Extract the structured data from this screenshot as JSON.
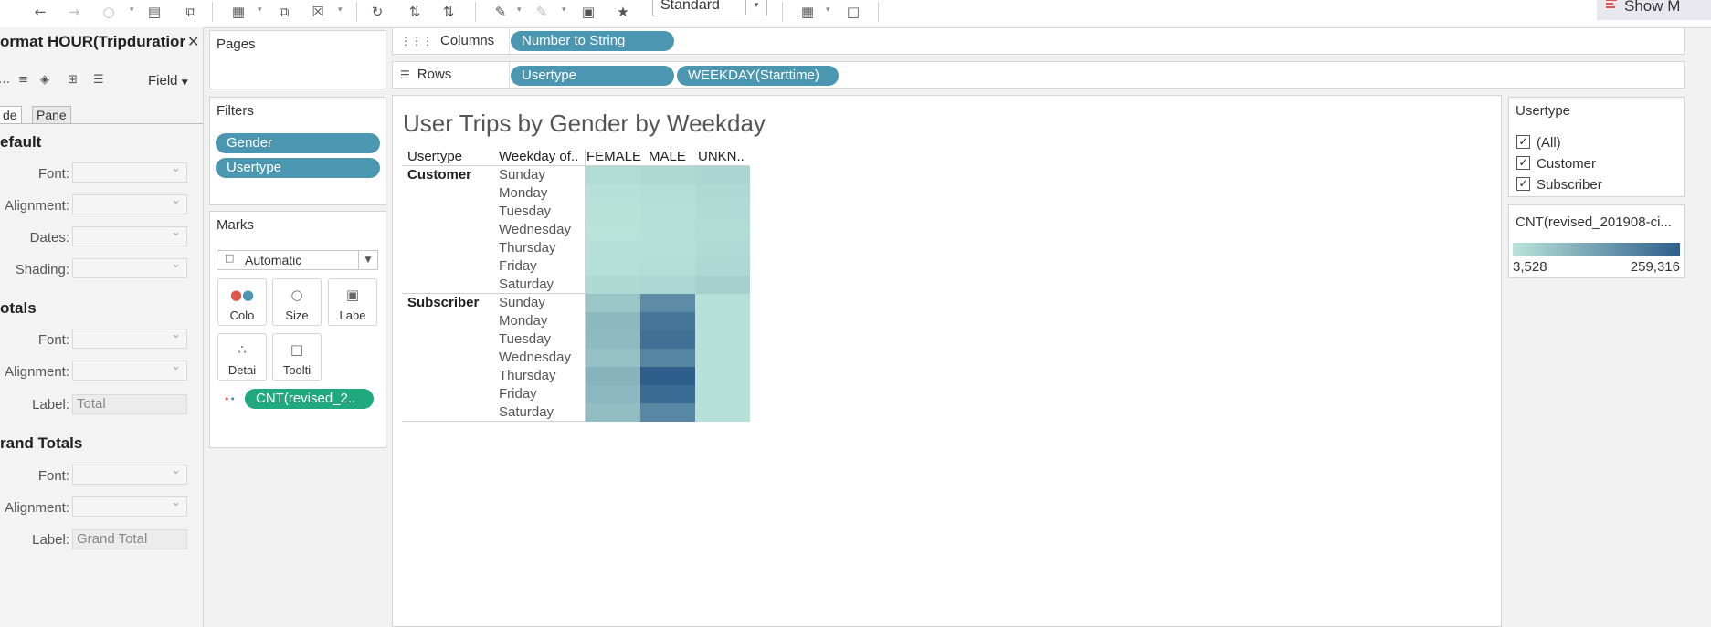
{
  "toolbar": {
    "icons": [
      "undo-icon",
      "redo-icon",
      "save-icon",
      "new-datasource-icon",
      "new-worksheet-icon",
      "duplicate-icon",
      "clear-icon",
      "swap-icon",
      "sort-asc-icon",
      "sort-desc-icon",
      "highlight-icon",
      "annotate-icon",
      "labels-icon",
      "pin-icon",
      "chart-icon",
      "presentation-icon"
    ],
    "fit_select": "Standard",
    "show_me": "Show M"
  },
  "format_pane": {
    "title": "ormat HOUR(Tripduratior",
    "field_label": "Field",
    "tabs": [
      "de",
      "Pane"
    ],
    "sections": [
      {
        "title": "efault",
        "rows": [
          {
            "label": "Font:"
          },
          {
            "label": "Alignment:"
          },
          {
            "label": "Dates:"
          },
          {
            "label": "Shading:"
          }
        ]
      },
      {
        "title": "otals",
        "rows": [
          {
            "label": "Font:"
          },
          {
            "label": "Alignment:"
          },
          {
            "label": "Label:",
            "value": "Total"
          }
        ]
      },
      {
        "title": "rand Totals",
        "rows": [
          {
            "label": "Font:"
          },
          {
            "label": "Alignment:"
          },
          {
            "label": "Label:",
            "value": "Grand Total"
          }
        ]
      }
    ]
  },
  "pages": {
    "title": "Pages"
  },
  "filters": {
    "title": "Filters",
    "items": [
      "Gender",
      "Usertype"
    ]
  },
  "marks": {
    "title": "Marks",
    "type": "Automatic",
    "buttons": [
      "Colo",
      "Size",
      "Labe",
      "Detai",
      "Toolti"
    ],
    "field": "CNT(revised_2.."
  },
  "columns_shelf": {
    "label": "Columns",
    "pills": [
      "Number to String"
    ]
  },
  "rows_shelf": {
    "label": "Rows",
    "pills": [
      "Usertype",
      "WEEKDAY(Starttime)"
    ]
  },
  "viz": {
    "title": "User Trips by Gender by Weekday",
    "headers": {
      "usertype": "Usertype",
      "weekday": "Weekday of..",
      "columns": [
        "FEMALE",
        "MALE",
        "UNKN.."
      ]
    },
    "groups": [
      {
        "name": "Customer",
        "days": [
          "Sunday",
          "Monday",
          "Tuesday",
          "Wednesday",
          "Thursday",
          "Friday",
          "Saturday"
        ]
      },
      {
        "name": "Subscriber",
        "days": [
          "Sunday",
          "Monday",
          "Tuesday",
          "Wednesday",
          "Thursday",
          "Friday",
          "Saturday"
        ]
      }
    ],
    "color_scale": {
      "low": "#b9e3d9",
      "high": "#2d5e8c"
    }
  },
  "chart_data": {
    "type": "heatmap",
    "title": "User Trips by Gender by Weekday",
    "rows": [
      "Customer / Sunday",
      "Customer / Monday",
      "Customer / Tuesday",
      "Customer / Wednesday",
      "Customer / Thursday",
      "Customer / Friday",
      "Customer / Saturday",
      "Subscriber / Sunday",
      "Subscriber / Monday",
      "Subscriber / Tuesday",
      "Subscriber / Wednesday",
      "Subscriber / Thursday",
      "Subscriber / Friday",
      "Subscriber / Saturday"
    ],
    "columns": [
      "FEMALE",
      "MALE",
      "UNKN.."
    ],
    "values": [
      [
        18000,
        22000,
        30000
      ],
      [
        8000,
        12000,
        22000
      ],
      [
        6000,
        10000,
        20000
      ],
      [
        4000,
        8000,
        16000
      ],
      [
        7000,
        11000,
        20000
      ],
      [
        10000,
        14000,
        24000
      ],
      [
        22000,
        26000,
        40000
      ],
      [
        60000,
        170000,
        8000
      ],
      [
        85000,
        215000,
        8000
      ],
      [
        82000,
        225000,
        8000
      ],
      [
        70000,
        185000,
        8000
      ],
      [
        95000,
        259316,
        8000
      ],
      [
        88000,
        235000,
        8000
      ],
      [
        75000,
        180000,
        8000
      ]
    ],
    "legend": {
      "title": "CNT(revised_201908-ci...",
      "min": 3528,
      "max": 259316,
      "min_label": "3,528",
      "max_label": "259,316"
    }
  },
  "usertype_filter": {
    "title": "Usertype",
    "options": [
      {
        "label": "(All)",
        "checked": true
      },
      {
        "label": "Customer",
        "checked": true
      },
      {
        "label": "Subscriber",
        "checked": true
      }
    ]
  },
  "color_legend": {
    "title": "CNT(revised_201908-ci...",
    "min_label": "3,528",
    "max_label": "259,316"
  }
}
